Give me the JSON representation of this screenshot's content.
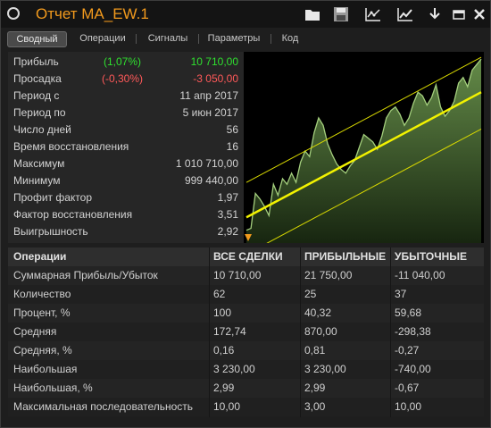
{
  "window": {
    "title": "Отчет MA_EW.1"
  },
  "toolbar": {
    "icons": [
      "folder-icon",
      "save-icon",
      "export-chart-icon",
      "chart-icon",
      "download-icon",
      "minimize-icon",
      "close-icon"
    ]
  },
  "tabs": [
    "Сводный",
    "Операции",
    "Сигналы",
    "Параметры",
    "Код"
  ],
  "active_tab": "Сводный",
  "colors": {
    "positive": "#2fe02f",
    "negative": "#ff5959",
    "title": "#f29a1d",
    "equity_line": "#a4cf7d",
    "trend_line": "#f2f200"
  },
  "summary": [
    {
      "label": "Прибыль",
      "pct": "(1,07%)",
      "value": "10 710,00",
      "tone": "positive"
    },
    {
      "label": "Просадка",
      "pct": "(-0,30%)",
      "value": "-3 050,00",
      "tone": "negative"
    },
    {
      "label": "Период с",
      "value": "11 апр 2017"
    },
    {
      "label": "Период по",
      "value": "5 июн 2017"
    },
    {
      "label": "Число дней",
      "value": "56"
    },
    {
      "label": "Время восстановления",
      "value": "16"
    },
    {
      "label": "Максимум",
      "value": "1 010 710,00"
    },
    {
      "label": "Минимум",
      "value": "999 440,00"
    },
    {
      "label": "Профит фактор",
      "value": "1,97"
    },
    {
      "label": "Фактор восстановления",
      "value": "3,51"
    },
    {
      "label": "Выигрышность",
      "value": "2,92"
    }
  ],
  "equity_chart": {
    "equity": [
      0.05,
      0.06,
      0.25,
      0.22,
      0.18,
      0.13,
      0.3,
      0.24,
      0.33,
      0.3,
      0.36,
      0.31,
      0.42,
      0.48,
      0.45,
      0.58,
      0.66,
      0.62,
      0.52,
      0.46,
      0.41,
      0.38,
      0.36,
      0.4,
      0.43,
      0.5,
      0.57,
      0.55,
      0.53,
      0.49,
      0.56,
      0.66,
      0.7,
      0.72,
      0.68,
      0.62,
      0.66,
      0.74,
      0.8,
      0.78,
      0.73,
      0.77,
      0.84,
      0.72,
      0.67,
      0.7,
      0.75,
      0.85,
      0.88,
      0.83,
      0.92,
      0.95,
      0.98
    ],
    "trend": [
      0.12,
      0.8
    ],
    "channel_upper": [
      0.31,
      0.99
    ],
    "channel_lower": [
      -0.08,
      0.6
    ]
  },
  "operations": {
    "columns": [
      "Операции",
      "ВСЕ СДЕЛКИ",
      "ПРИБЫЛЬНЫЕ",
      "УБЫТОЧНЫЕ"
    ],
    "rows": [
      [
        "Суммарная Прибыль/Убыток",
        "10 710,00",
        "21 750,00",
        "-11 040,00"
      ],
      [
        "Количество",
        "62",
        "25",
        "37"
      ],
      [
        "Процент, %",
        "100",
        "40,32",
        "59,68"
      ],
      [
        "Средняя",
        "172,74",
        "870,00",
        "-298,38"
      ],
      [
        "Средняя, %",
        "0,16",
        "0,81",
        "-0,27"
      ],
      [
        "Наибольшая",
        "3 230,00",
        "3 230,00",
        "-740,00"
      ],
      [
        "Наибольшая, %",
        "2,99",
        "2,99",
        "-0,67"
      ],
      [
        "Максимальная последовательность",
        "10,00",
        "3,00",
        "10,00"
      ]
    ]
  }
}
